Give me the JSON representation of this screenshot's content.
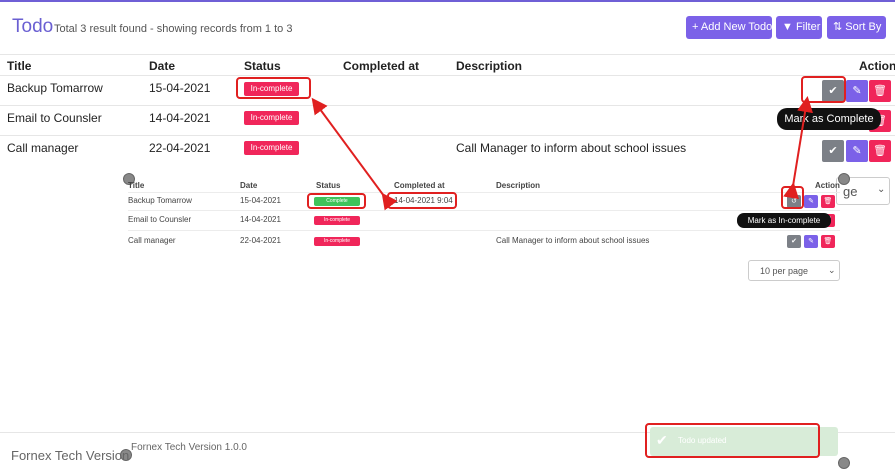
{
  "header": {
    "title": "Todo",
    "subtitle": "Total 3 result found - showing records from 1 to 3",
    "add_button": "+ Add New Todo",
    "filter_button": "Filter",
    "sort_button": "Sort By"
  },
  "table": {
    "columns": [
      "Title",
      "Date",
      "Status",
      "Completed at",
      "Description",
      "Action"
    ],
    "rows": [
      {
        "title": "Backup Tomarrow",
        "date": "15-04-2021",
        "status": "In-complete",
        "completed_at": "",
        "description": ""
      },
      {
        "title": "Email to Counsler",
        "date": "14-04-2021",
        "status": "In-complete",
        "completed_at": "",
        "description": ""
      },
      {
        "title": "Call manager",
        "date": "22-04-2021",
        "status": "In-complete",
        "completed_at": "",
        "description": "Call Manager to inform about school issues"
      }
    ]
  },
  "tooltip_complete": "Mark as Complete",
  "partial_select": "ge",
  "embedded": {
    "columns": [
      "Title",
      "Date",
      "Status",
      "Completed at",
      "Description",
      "Action"
    ],
    "rows": [
      {
        "title": "Backup Tomarrow",
        "date": "15-04-2021",
        "status": "Complete",
        "completed_at": "14-04-2021 9:04",
        "description": ""
      },
      {
        "title": "Email to Counsler",
        "date": "14-04-2021",
        "status": "In-complete",
        "completed_at": "",
        "description": ""
      },
      {
        "title": "Call manager",
        "date": "22-04-2021",
        "status": "In-complete",
        "completed_at": "",
        "description": "Call Manager to inform about school issues"
      }
    ],
    "tooltip_incomplete": "Mark as In-complete",
    "per_page": "10 per page",
    "footer": "Fornex Tech Version 1.0.0"
  },
  "footer": "Fornex Tech Version",
  "toast": "Todo updated",
  "colors": {
    "accent": "#7b61e8",
    "danger": "#f0265a",
    "success": "#3fc35b",
    "annotation": "#e02020"
  }
}
